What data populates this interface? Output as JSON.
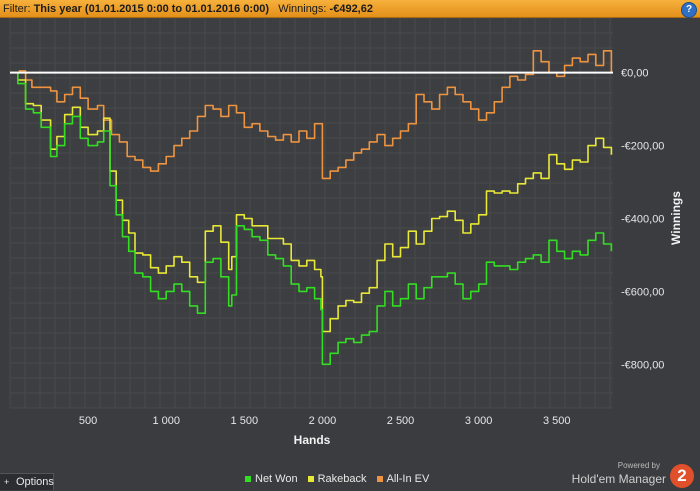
{
  "filterbar": {
    "filter_label": "Filter:",
    "filter_value": "This year (01.01.2015 0:00 to 01.01.2016 0:00)",
    "winnings_label": "Winnings:",
    "winnings_value": "-€492,62",
    "help_symbol": "?"
  },
  "chart_data": {
    "type": "line",
    "xlabel": "Hands",
    "ylabel": "Winnings",
    "xlim": [
      0,
      3860
    ],
    "ylim": [
      -920,
      150
    ],
    "x_ticks": [
      500,
      1000,
      1500,
      2000,
      2500,
      3000,
      3500
    ],
    "x_tick_labels": [
      "500",
      "1 000",
      "1 500",
      "2 000",
      "2 500",
      "3 000",
      "3 500"
    ],
    "y_ticks": [
      0,
      -200,
      -400,
      -600,
      -800
    ],
    "y_tick_labels": [
      "€0,00",
      "-€200,00",
      "-€400,00",
      "-€600,00",
      "-€800,00"
    ],
    "grid": true,
    "legend_position": "bottom",
    "series": [
      {
        "name": "Net Won",
        "color": "#33dd22",
        "x": [
          0,
          50,
          100,
          150,
          200,
          260,
          300,
          350,
          400,
          450,
          500,
          560,
          600,
          640,
          680,
          720,
          760,
          800,
          850,
          900,
          950,
          1000,
          1050,
          1100,
          1150,
          1200,
          1250,
          1300,
          1350,
          1400,
          1420,
          1450,
          1500,
          1550,
          1600,
          1650,
          1700,
          1750,
          1800,
          1850,
          1900,
          1950,
          1990,
          2000,
          2050,
          2100,
          2150,
          2200,
          2250,
          2300,
          2350,
          2400,
          2450,
          2500,
          2550,
          2600,
          2650,
          2700,
          2750,
          2800,
          2850,
          2900,
          2950,
          3000,
          3050,
          3100,
          3150,
          3200,
          3250,
          3300,
          3350,
          3400,
          3450,
          3500,
          3550,
          3600,
          3650,
          3700,
          3750,
          3800,
          3850
        ],
        "values": [
          0,
          -30,
          -100,
          -110,
          -150,
          -230,
          -200,
          -140,
          -120,
          -180,
          -200,
          -190,
          -160,
          -310,
          -390,
          -450,
          -490,
          -550,
          -560,
          -600,
          -620,
          -600,
          -580,
          -600,
          -640,
          -660,
          -520,
          -510,
          -560,
          -640,
          -610,
          -420,
          -430,
          -450,
          -460,
          -500,
          -510,
          -530,
          -580,
          -600,
          -590,
          -620,
          -650,
          -800,
          -770,
          -740,
          -730,
          -740,
          -720,
          -710,
          -640,
          -600,
          -640,
          -620,
          -580,
          -620,
          -590,
          -560,
          -560,
          -550,
          -580,
          -620,
          -600,
          -580,
          -520,
          -530,
          -530,
          -540,
          -520,
          -510,
          -500,
          -520,
          -460,
          -490,
          -510,
          -490,
          -500,
          -460,
          -440,
          -470,
          -490
        ]
      },
      {
        "name": "Rakeback",
        "color": "#e8e836",
        "x": [
          0,
          50,
          100,
          150,
          200,
          260,
          300,
          350,
          400,
          450,
          500,
          560,
          600,
          640,
          680,
          720,
          760,
          800,
          850,
          900,
          950,
          1000,
          1050,
          1100,
          1150,
          1200,
          1250,
          1300,
          1350,
          1400,
          1420,
          1450,
          1500,
          1550,
          1600,
          1650,
          1700,
          1750,
          1800,
          1850,
          1900,
          1950,
          1990,
          2000,
          2050,
          2100,
          2150,
          2200,
          2250,
          2300,
          2350,
          2400,
          2450,
          2500,
          2550,
          2600,
          2650,
          2700,
          2750,
          2800,
          2850,
          2900,
          2950,
          3000,
          3050,
          3100,
          3150,
          3200,
          3250,
          3300,
          3350,
          3400,
          3450,
          3500,
          3550,
          3600,
          3650,
          3700,
          3750,
          3800,
          3850
        ],
        "values": [
          0,
          -20,
          -85,
          -90,
          -130,
          -210,
          -175,
          -115,
          -95,
          -150,
          -170,
          -160,
          -125,
          -270,
          -350,
          -405,
          -440,
          -495,
          -500,
          -535,
          -550,
          -530,
          -505,
          -520,
          -560,
          -575,
          -435,
          -420,
          -465,
          -540,
          -505,
          -390,
          -400,
          -420,
          -420,
          -455,
          -455,
          -470,
          -515,
          -530,
          -515,
          -540,
          -560,
          -710,
          -675,
          -640,
          -625,
          -630,
          -605,
          -590,
          -515,
          -470,
          -505,
          -480,
          -435,
          -470,
          -435,
          -400,
          -395,
          -380,
          -405,
          -440,
          -415,
          -390,
          -325,
          -330,
          -325,
          -330,
          -305,
          -290,
          -275,
          -290,
          -225,
          -250,
          -265,
          -240,
          -245,
          -200,
          -180,
          -205,
          -225
        ]
      },
      {
        "name": "All-In EV",
        "color": "#ee9440",
        "x": [
          0,
          60,
          100,
          140,
          200,
          260,
          300,
          350,
          400,
          450,
          500,
          560,
          600,
          650,
          700,
          750,
          800,
          850,
          900,
          950,
          1000,
          1050,
          1100,
          1150,
          1200,
          1250,
          1300,
          1350,
          1400,
          1450,
          1500,
          1550,
          1600,
          1650,
          1700,
          1750,
          1800,
          1850,
          1900,
          1950,
          2000,
          2050,
          2100,
          2150,
          2200,
          2250,
          2300,
          2350,
          2400,
          2450,
          2500,
          2550,
          2600,
          2650,
          2700,
          2750,
          2800,
          2850,
          2900,
          2950,
          3000,
          3050,
          3100,
          3150,
          3200,
          3250,
          3300,
          3350,
          3400,
          3450,
          3500,
          3550,
          3600,
          3650,
          3700,
          3750,
          3800,
          3850
        ],
        "values": [
          0,
          5,
          -20,
          -40,
          -40,
          -50,
          -80,
          -60,
          -40,
          -70,
          -100,
          -90,
          -130,
          -170,
          -190,
          -230,
          -240,
          -260,
          -270,
          -250,
          -230,
          -200,
          -180,
          -160,
          -120,
          -90,
          -100,
          -120,
          -90,
          -110,
          -150,
          -140,
          -160,
          -175,
          -185,
          -170,
          -190,
          -160,
          -180,
          -140,
          -290,
          -270,
          -260,
          -240,
          -220,
          -210,
          -190,
          -170,
          -200,
          -180,
          -160,
          -140,
          -60,
          -80,
          -100,
          -60,
          -40,
          -60,
          -80,
          -100,
          -130,
          -110,
          -80,
          -40,
          -10,
          -20,
          -5,
          60,
          30,
          0,
          -10,
          20,
          40,
          30,
          50,
          20,
          60,
          0
        ]
      }
    ],
    "reference_line": {
      "y": 0,
      "color": "#ffffff"
    }
  },
  "legend": {
    "items": [
      {
        "label": "Net Won",
        "color": "#33dd22"
      },
      {
        "label": "Rakeback",
        "color": "#e8e836"
      },
      {
        "label": "All-In EV",
        "color": "#ee9440"
      }
    ]
  },
  "options": {
    "plus": "+",
    "label": "Options"
  },
  "branding": {
    "powered_by": "Powered by",
    "name": "Hold'em Manager",
    "logo_text": "2"
  }
}
